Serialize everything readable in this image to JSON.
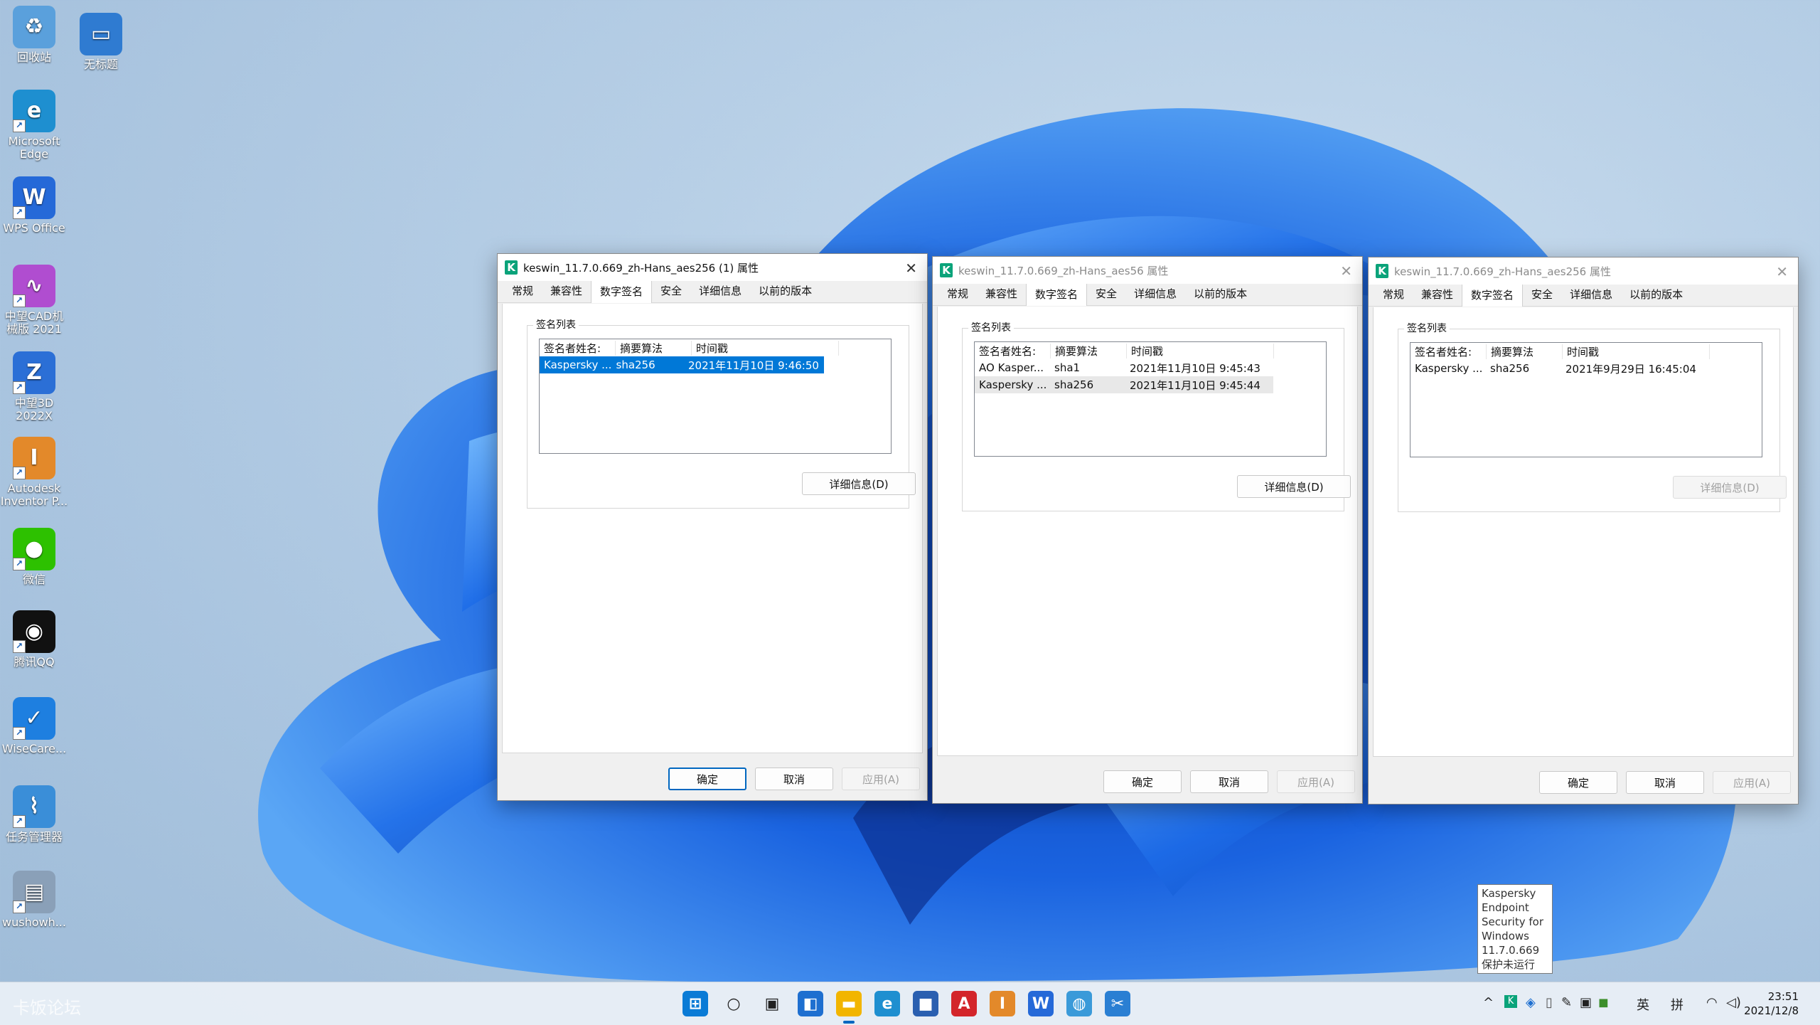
{
  "desktop": {
    "icons": [
      {
        "label": "回收站",
        "icon": "recycle-bin-icon",
        "color": "#5aa0dc"
      },
      {
        "label": "无标题",
        "icon": "folder-icon",
        "color": "#2f7bd1"
      },
      {
        "label": "Microsoft Edge",
        "icon": "edge-icon",
        "color": "#1e8fd0"
      },
      {
        "label": "WPS Office",
        "icon": "wps-icon",
        "color": "#2569d8"
      },
      {
        "label": "中望CAD机械版 2021",
        "icon": "zwcad-icon",
        "color": "#b04dd0"
      },
      {
        "label": "中望3D 2022X",
        "icon": "zw3d-icon",
        "color": "#2b6fd6"
      },
      {
        "label": "Autodesk Inventor P...",
        "icon": "inventor-icon",
        "color": "#e3892a"
      },
      {
        "label": "微信",
        "icon": "wechat-icon",
        "color": "#2dc100"
      },
      {
        "label": "腾讯QQ",
        "icon": "qq-icon",
        "color": "#111111"
      },
      {
        "label": "WiseCare...",
        "icon": "wisecare-icon",
        "color": "#1e7fe0"
      },
      {
        "label": "任务管理器",
        "icon": "task-manager-icon",
        "color": "#3a8ed8"
      },
      {
        "label": "wushowh...",
        "icon": "app-icon",
        "color": "#8aa0b8"
      }
    ]
  },
  "dialogs": [
    {
      "title": "keswin_11.7.0.669_zh-Hans_aes256 (1) 属性",
      "tabs": [
        "常规",
        "兼容性",
        "数字签名",
        "安全",
        "详细信息",
        "以前的版本"
      ],
      "group_label": "签名列表",
      "columns": [
        "签名者姓名:",
        "摘要算法",
        "时间戳"
      ],
      "rows": [
        [
          "Kaspersky ...",
          "sha256",
          "2021年11月10日 9:46:50"
        ]
      ],
      "details_button": "详细信息(D)",
      "ok": "确定",
      "cancel": "取消",
      "apply": "应用(A)"
    },
    {
      "title": "keswin_11.7.0.669_zh-Hans_aes56 属性",
      "tabs": [
        "常规",
        "兼容性",
        "数字签名",
        "安全",
        "详细信息",
        "以前的版本"
      ],
      "group_label": "签名列表",
      "columns": [
        "签名者姓名:",
        "摘要算法",
        "时间戳"
      ],
      "rows": [
        [
          "AO Kasper...",
          "sha1",
          "2021年11月10日 9:45:43"
        ],
        [
          "Kaspersky ...",
          "sha256",
          "2021年11月10日 9:45:44"
        ]
      ],
      "details_button": "详细信息(D)",
      "ok": "确定",
      "cancel": "取消",
      "apply": "应用(A)"
    },
    {
      "title": "keswin_11.7.0.669_zh-Hans_aes256 属性",
      "tabs": [
        "常规",
        "兼容性",
        "数字签名",
        "安全",
        "详细信息",
        "以前的版本"
      ],
      "group_label": "签名列表",
      "columns": [
        "签名者姓名:",
        "摘要算法",
        "时间戳"
      ],
      "rows": [
        [
          "Kaspersky ...",
          "sha256",
          "2021年9月29日 16:45:04"
        ]
      ],
      "details_button": "详细信息(D)",
      "ok": "确定",
      "cancel": "取消",
      "apply": "应用(A)"
    }
  ],
  "tooltip": {
    "lines": [
      "Kaspersky",
      "Endpoint",
      "Security for",
      "Windows",
      "11.7.0.669",
      "保护未运行"
    ]
  },
  "taskbar": {
    "watermark": "卡饭论坛",
    "apps": [
      {
        "icon": "start-icon",
        "color": "#0a7bd6",
        "glyph": "⊞"
      },
      {
        "icon": "search-icon",
        "color": "#222222",
        "glyph": "○"
      },
      {
        "icon": "task-view-icon",
        "color": "#222222",
        "glyph": "▣"
      },
      {
        "icon": "widgets-icon",
        "color": "#1e6fd0",
        "glyph": "◧"
      },
      {
        "icon": "file-explorer-icon",
        "color": "#f2b500",
        "glyph": "▬"
      },
      {
        "icon": "edge-icon",
        "color": "#1e8fd0",
        "glyph": "e"
      },
      {
        "icon": "store-icon",
        "color": "#2a5fb0",
        "glyph": "■"
      },
      {
        "icon": "acrobat-icon",
        "color": "#d3252a",
        "glyph": "A"
      },
      {
        "icon": "inventor-icon",
        "color": "#e3892a",
        "glyph": "I"
      },
      {
        "icon": "wps-icon",
        "color": "#2569d8",
        "glyph": "W"
      },
      {
        "icon": "browser-icon",
        "color": "#3a9ad9",
        "glyph": "◍"
      },
      {
        "icon": "snipping-tool-icon",
        "color": "#2a7fd3",
        "glyph": "✂"
      }
    ],
    "tray": {
      "chevron": "^",
      "ime_lang": "英",
      "ime_mode": "拼",
      "time": "23:51",
      "date": "2021/12/8"
    }
  }
}
